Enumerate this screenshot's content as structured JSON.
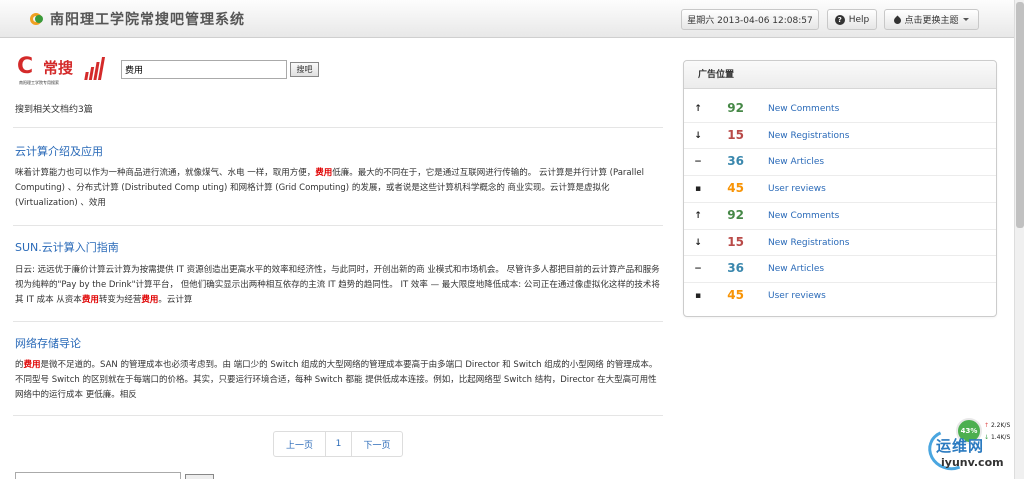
{
  "header": {
    "title": "南阳理工学院常搜吧管理系统",
    "datetime": "星期六 2013-04-06 12:08:57",
    "help_label": "Help",
    "theme_label": "点击更换主题"
  },
  "search": {
    "logo_char": "C",
    "logo_text": "常搜",
    "logo_sub": "南阳理工学院专用搜索",
    "query": "费用",
    "button_label": "搜吧",
    "result_count": "搜到相关文档约3篇"
  },
  "articles": [
    {
      "title": "云计算介绍及应用",
      "segments": [
        "咪着计算能力也可以作为一种商品进行流通，就像煤气、水电 一样，取用方便，",
        "费用",
        "低廉。最大的不同在于，它是通过互联网进行传输的。 云计算是并行计算 (Parallel Computing) 、分布式计算 (Distributed Comp uting) 和网格计算 (Grid Computing) 的发展，或者说是这些计算机科学概念的 商业实现。云计算是虚拟化 (Virtualization) 、效用"
      ]
    },
    {
      "title": "SUN.云计算入门指南",
      "segments": [
        "日云: 远远优于廉价计算云计算为按需提供 IT 资源创造出更高水平的效率和经济性，与此同时，开创出新的商 业模式和市场机会。 尽管许多人都把目前的云计算产品和服务视为纯粹的\"Pay by the Drink\"计算平台， 但他们确实显示出两种相互依存的主流 IT 趋势的趋同性。 IT 效率 — 最大限度地降低成本: 公司正在通过像虚拟化这样的技术将其 IT 成本 从资本",
        "费用",
        "转变为经营",
        "费用",
        "。云计算"
      ]
    },
    {
      "title": "网络存储导论",
      "segments": [
        "的",
        "费用",
        "是微不足道的。SAN 的管理成本也必须考虑到。由 端口少的 Switch 组成的大型网络的管理成本要高于由多端口 Director 和 Switch 组成的小型网络 的管理成本。 不同型号 Switch 的区别就在于每端口的价格。其实，只要运行环境合适，每种 Switch 都能 提供低成本连接。例如，比起网络型 Switch 结构，Director 在大型高可用性网络中的运行成本 更低廉。相反"
      ]
    }
  ],
  "pagination": {
    "prev": "上一页",
    "page": "1",
    "next": "下一页"
  },
  "panel": {
    "title": "广告位置",
    "stats": [
      {
        "icon": "arrow-up-icon",
        "glyph": "↑",
        "value": "92",
        "label": "New Comments",
        "color": "#468847"
      },
      {
        "icon": "arrow-down-icon",
        "glyph": "↓",
        "value": "15",
        "label": "New Registrations",
        "color": "#b94a48"
      },
      {
        "icon": "minus-icon",
        "glyph": "−",
        "value": "36",
        "label": "New Articles",
        "color": "#3a87ad"
      },
      {
        "icon": "comment-icon",
        "glyph": "▪",
        "value": "45",
        "label": "User reviews",
        "color": "#f89406"
      },
      {
        "icon": "arrow-up-icon",
        "glyph": "↑",
        "value": "92",
        "label": "New Comments",
        "color": "#468847"
      },
      {
        "icon": "arrow-down-icon",
        "glyph": "↓",
        "value": "15",
        "label": "New Registrations",
        "color": "#b94a48"
      },
      {
        "icon": "minus-icon",
        "glyph": "−",
        "value": "36",
        "label": "New Articles",
        "color": "#3a87ad"
      },
      {
        "icon": "comment-icon",
        "glyph": "▪",
        "value": "45",
        "label": "User reviews",
        "color": "#f89406"
      }
    ]
  },
  "overlay": {
    "gauge": "43%",
    "up_speed": "2.2K/S",
    "down_speed": "1.4K/S",
    "watermark_text": "运维网",
    "watermark_url": "iyunv.com"
  }
}
